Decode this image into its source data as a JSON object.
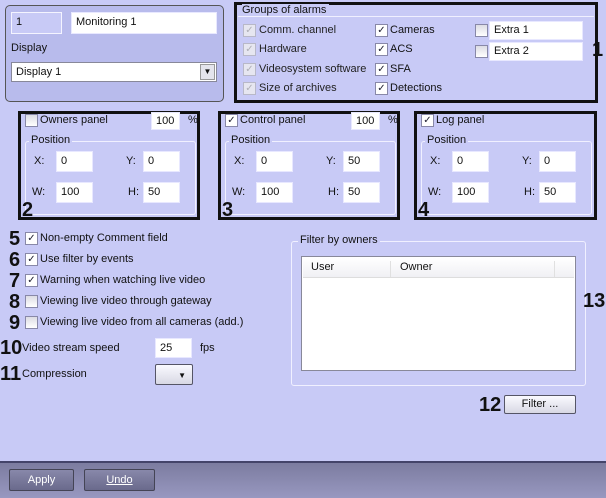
{
  "header": {
    "id": "1",
    "name": "Monitoring 1",
    "display_label": "Display",
    "display_value": "Display 1"
  },
  "alarms": {
    "title": "Groups of alarms",
    "col1": [
      {
        "label": "Comm. channel",
        "checked": true,
        "disabled": true
      },
      {
        "label": "Hardware",
        "checked": true,
        "disabled": true
      },
      {
        "label": "Videosystem software",
        "checked": true,
        "disabled": true
      },
      {
        "label": "Size of archives",
        "checked": true,
        "disabled": true
      }
    ],
    "col2": [
      {
        "label": "Cameras",
        "checked": true
      },
      {
        "label": "ACS",
        "checked": true
      },
      {
        "label": "SFA",
        "checked": true
      },
      {
        "label": "Detections",
        "checked": true
      }
    ],
    "extras": [
      {
        "value": "Extra 1",
        "checked": false
      },
      {
        "value": "Extra 2",
        "checked": false
      }
    ]
  },
  "panels": [
    {
      "label": "Owners panel",
      "checked": false,
      "percent": "100",
      "unit": "%",
      "x": "0",
      "y": "0",
      "w": "100",
      "h": "50",
      "num": "2"
    },
    {
      "label": "Control panel",
      "checked": true,
      "percent": "100",
      "unit": "%",
      "x": "0",
      "y": "50",
      "w": "100",
      "h": "50",
      "num": "3"
    },
    {
      "label": "Log panel",
      "checked": true,
      "x": "0",
      "y": "0",
      "w": "100",
      "h": "50",
      "num": "4"
    }
  ],
  "position_label": "Position",
  "x_label": "X:",
  "y_label": "Y:",
  "w_label": "W:",
  "h_label": "H:",
  "options": [
    {
      "num": "5",
      "label": "Non-empty Comment field",
      "checked": true
    },
    {
      "num": "6",
      "label": "Use filter by events",
      "checked": true
    },
    {
      "num": "7",
      "label": "Warning when watching live video",
      "checked": true
    },
    {
      "num": "8",
      "label": "Viewing live video through gateway",
      "checked": false
    },
    {
      "num": "9",
      "label": "Viewing live video from all cameras (add.)",
      "checked": false
    }
  ],
  "speed": {
    "num": "10",
    "label": "Video stream speed",
    "value": "25",
    "unit": "fps"
  },
  "compression": {
    "num": "11",
    "label": "Compression"
  },
  "filter": {
    "title": "Filter by owners",
    "columns": [
      "User",
      "Owner"
    ],
    "num": "13",
    "button": "Filter ...",
    "button_num": "12"
  },
  "group1_num": "1",
  "footer": {
    "apply": "Apply",
    "undo": "Undo"
  }
}
